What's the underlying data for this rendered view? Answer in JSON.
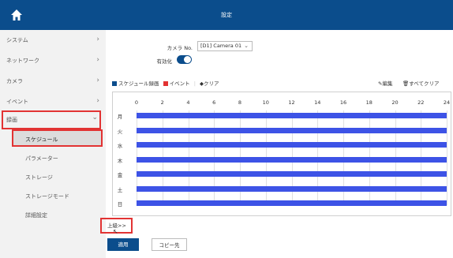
{
  "header": {
    "title": "設定"
  },
  "sidebar": {
    "items": [
      {
        "label": "システム",
        "chevron": "›"
      },
      {
        "label": "ネットワーク",
        "chevron": "›"
      },
      {
        "label": "カメラ",
        "chevron": "›"
      },
      {
        "label": "イベント",
        "chevron": "›"
      },
      {
        "label": "録画",
        "chevron": "⌄"
      }
    ],
    "subitems": [
      "スケジュール",
      "パラメーター",
      "ストレージ",
      "ストレージモード",
      "詳細設定"
    ]
  },
  "form": {
    "camera_label": "カメラ No.",
    "camera_value": "[D1] Camera 01",
    "enable_label": "有効化"
  },
  "toolbar": {
    "legend_schedule": "スケジュール録画",
    "legend_event": "イベント",
    "clear": "クリア",
    "edit": "編集",
    "clear_all": "すべてクリア"
  },
  "colors": {
    "schedule": "#3d53e6",
    "event": "#e23333",
    "accent": "#0b4d8c"
  },
  "schedule": {
    "hours": [
      "0",
      "2",
      "4",
      "6",
      "8",
      "10",
      "12",
      "14",
      "16",
      "18",
      "20",
      "22",
      "24"
    ],
    "days": [
      "月",
      "火",
      "水",
      "木",
      "金",
      "土",
      "日"
    ],
    "coverage_fraction": 1.0
  },
  "footer": {
    "copy_link": "上級>>",
    "apply": "適用",
    "copy_to": "コピー先"
  }
}
